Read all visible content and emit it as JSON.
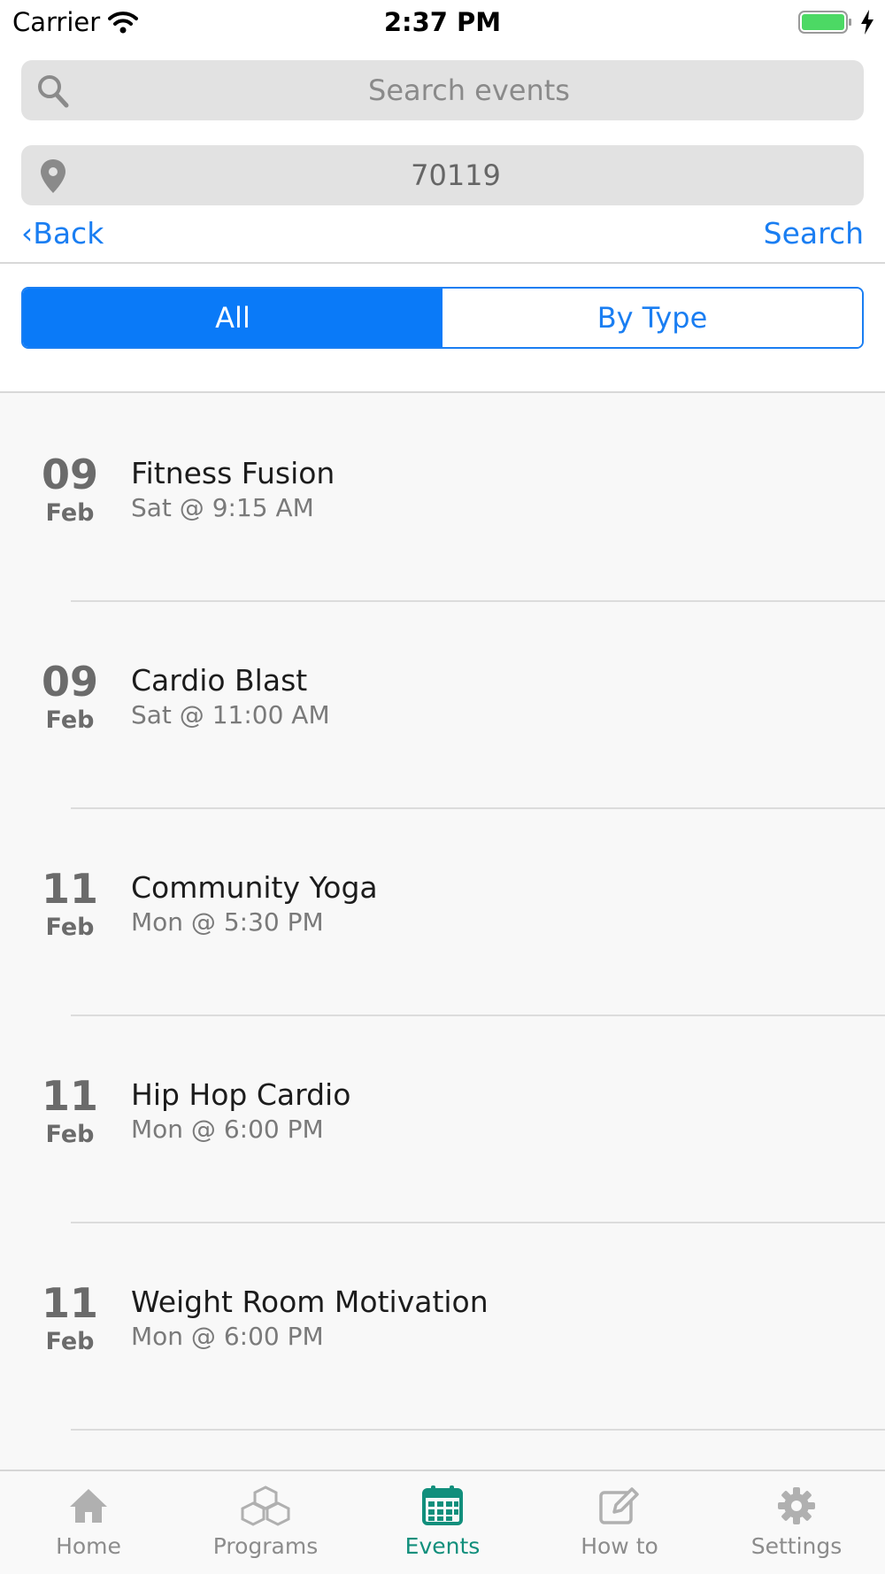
{
  "status_bar": {
    "carrier": "Carrier",
    "time": "2:37 PM"
  },
  "search": {
    "placeholder": "Search events",
    "location_value": "70119"
  },
  "nav": {
    "back_label": "‹Back",
    "search_label": "Search"
  },
  "segments": {
    "all_label": "All",
    "by_type_label": "By Type",
    "selected": "All"
  },
  "events": [
    {
      "day": "09",
      "month": "Feb",
      "title": "Fitness Fusion",
      "time": "Sat @ 9:15 AM"
    },
    {
      "day": "09",
      "month": "Feb",
      "title": "Cardio Blast",
      "time": "Sat @ 11:00 AM"
    },
    {
      "day": "11",
      "month": "Feb",
      "title": "Community Yoga",
      "time": "Mon @ 5:30 PM"
    },
    {
      "day": "11",
      "month": "Feb",
      "title": "Hip Hop Cardio",
      "time": "Mon @ 6:00 PM"
    },
    {
      "day": "11",
      "month": "Feb",
      "title": "Weight Room Motivation",
      "time": "Mon @ 6:00 PM"
    }
  ],
  "tab_bar": {
    "home": "Home",
    "programs": "Programs",
    "events": "Events",
    "how_to": "How to",
    "settings": "Settings",
    "active": "Events"
  },
  "colors": {
    "accent": "#0a7af8",
    "tab_active": "#118f7c",
    "inactive": "#8c8c8c",
    "battery": "#4cd964"
  },
  "icons": [
    "wifi-icon",
    "battery-icon",
    "bolt-icon",
    "search-icon",
    "location-pin-icon",
    "home-icon",
    "programs-cubes-icon",
    "calendar-icon",
    "edit-icon",
    "gear-icon"
  ]
}
